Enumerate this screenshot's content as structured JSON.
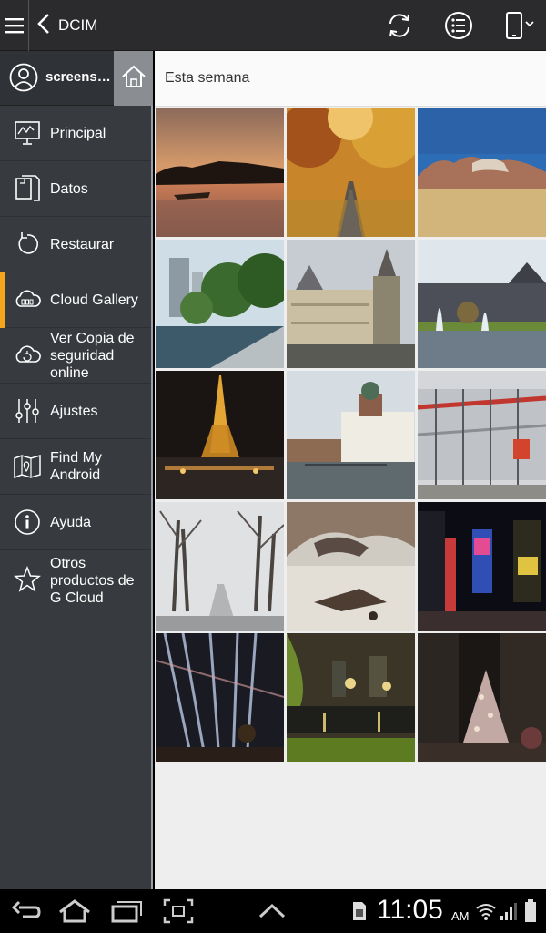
{
  "topbar": {
    "title": "DCIM",
    "icons": [
      "menu-icon",
      "back-icon",
      "sync-icon",
      "list-view-icon",
      "device-icon"
    ]
  },
  "account": {
    "name": "screens…"
  },
  "sidebar": {
    "items": [
      {
        "label": "Principal",
        "icon": "presentation-icon",
        "active": false
      },
      {
        "label": "Datos",
        "icon": "documents-icon",
        "active": false
      },
      {
        "label": "Restaurar",
        "icon": "restore-icon",
        "active": false
      },
      {
        "label": "Cloud Gallery",
        "icon": "cloud-gallery-icon",
        "active": true
      },
      {
        "label": "Ver Copia de seguridad online",
        "icon": "cloud-backup-icon",
        "active": false
      },
      {
        "label": "Ajustes",
        "icon": "sliders-icon",
        "active": false
      },
      {
        "label": "Find My Android",
        "icon": "map-icon",
        "active": false
      },
      {
        "label": "Ayuda",
        "icon": "info-icon",
        "active": false
      },
      {
        "label": "Otros productos de G Cloud",
        "icon": "star-icon",
        "active": false
      }
    ],
    "accent_color": "#f4a51c"
  },
  "main": {
    "section_title": "Esta semana",
    "photos": [
      "sunset-lake-photo",
      "autumn-road-photo",
      "desert-mountains-photo",
      "city-park-photo",
      "paris-hotel-de-ville-photo",
      "louvre-fountain-photo",
      "eiffel-tower-night-photo",
      "helsinki-cathedral-photo",
      "centre-pompidou-photo",
      "winter-trees-path-photo",
      "shipwreck-painting-photo",
      "times-square-night-photo",
      "light-trails-photo",
      "night-pond-photo",
      "christmas-tree-plaza-photo"
    ]
  },
  "statusbar": {
    "time": "11:05",
    "ampm": "AM",
    "icons": [
      "back-nav-icon",
      "home-nav-icon",
      "recent-apps-icon",
      "screenshot-icon",
      "up-arrow-icon",
      "sd-card-icon",
      "usb-icon",
      "wifi-icon",
      "signal-icon",
      "battery-icon"
    ]
  }
}
